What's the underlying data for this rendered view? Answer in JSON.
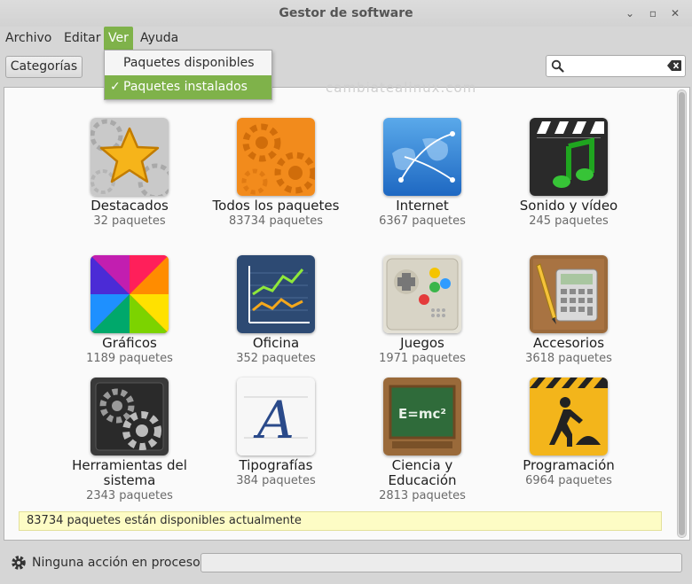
{
  "window": {
    "title": "Gestor de software"
  },
  "menubar": {
    "items": [
      "Archivo",
      "Editar",
      "Ver",
      "Ayuda"
    ]
  },
  "ver_menu": {
    "items": [
      "Paquetes disponibles",
      "Paquetes instalados"
    ],
    "checked": "✓"
  },
  "toolbar": {
    "categories_label": "Categorías",
    "search_value": ""
  },
  "watermark": "cambiatealinux.com",
  "categories": [
    {
      "name": "Destacados",
      "count": "32 paquetes"
    },
    {
      "name": "Todos los paquetes",
      "count": "83734 paquetes"
    },
    {
      "name": "Internet",
      "count": "6367 paquetes"
    },
    {
      "name": "Sonido y vídeo",
      "count": "245 paquetes"
    },
    {
      "name": "Gráficos",
      "count": "1189 paquetes"
    },
    {
      "name": "Oficina",
      "count": "352 paquetes"
    },
    {
      "name": "Juegos",
      "count": "1971 paquetes"
    },
    {
      "name": "Accesorios",
      "count": "3618 paquetes"
    },
    {
      "name": "Herramientas del sistema",
      "count": "2343 paquetes"
    },
    {
      "name": "Tipografías",
      "count": "384 paquetes"
    },
    {
      "name": "Ciencia y Educación",
      "count": "2813 paquetes"
    },
    {
      "name": "Programación",
      "count": "6964 paquetes"
    }
  ],
  "status_message": "83734 paquetes están disponibles actualmente",
  "bottom": {
    "progress_text": "Ninguna acción en proceso"
  },
  "icons": {
    "window": [
      "minimize-icon",
      "maximize-icon",
      "close-icon"
    ],
    "search": "search-icon",
    "clear": "clear-icon",
    "process": "gear-icon"
  },
  "colors": {
    "accent": "#7fb24a",
    "status_bg": "#fdfcc5"
  }
}
